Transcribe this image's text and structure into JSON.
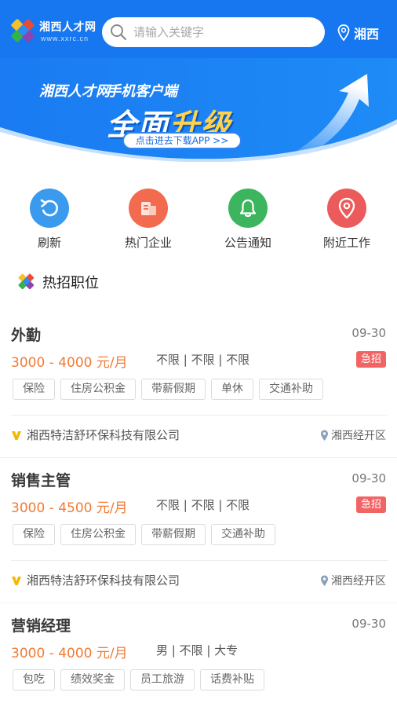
{
  "header": {
    "logo_title": "湘西人才网",
    "logo_url": "www.xxrc.cn",
    "search_placeholder": "请输入关键字",
    "location": "湘西",
    "icons": {
      "search": "search-icon",
      "location": "map-pin-icon"
    },
    "colors": {
      "primary": "#1677f0"
    }
  },
  "banner": {
    "brand": "湘西人才网",
    "client": "手机客户端",
    "main_prefix": "全面",
    "main_highlight": "升级",
    "cta": "点击进去下载APP >>"
  },
  "quick_nav": [
    {
      "label": "刷新",
      "icon": "refresh-icon",
      "color": "#3a9bee"
    },
    {
      "label": "热门企业",
      "icon": "building-icon",
      "color": "#f26b4e"
    },
    {
      "label": "公告通知",
      "icon": "bell-icon",
      "color": "#3cb55e"
    },
    {
      "label": "附近工作",
      "icon": "location-pin-icon",
      "color": "#ec5b5b"
    }
  ],
  "section": {
    "title": "热招职位",
    "icon": "logo-mark-icon"
  },
  "jobs": [
    {
      "title": "外勤",
      "date": "09-30",
      "salary": "3000 - 4000 元/月",
      "requirements": "不限 | 不限 | 不限",
      "urgent": "急招",
      "tags": [
        "保险",
        "住房公积金",
        "带薪假期",
        "单休",
        "交通补助"
      ],
      "company": "湘西特洁舒环保科技有限公司",
      "area": "湘西经开区"
    },
    {
      "title": "销售主管",
      "date": "09-30",
      "salary": "3000 - 4500 元/月",
      "requirements": "不限 | 不限 | 不限",
      "urgent": "急招",
      "tags": [
        "保险",
        "住房公积金",
        "带薪假期",
        "交通补助"
      ],
      "company": "湘西特洁舒环保科技有限公司",
      "area": "湘西经开区"
    },
    {
      "title": "营销经理",
      "date": "09-30",
      "salary": "3000 - 4000 元/月",
      "requirements": "男 | 不限 | 大专",
      "urgent": "",
      "tags": [
        "包吃",
        "绩效奖金",
        "员工旅游",
        "话费补贴"
      ],
      "company": "",
      "area": ""
    }
  ],
  "colors": {
    "salary": "#f17b35",
    "urgent": "#f26364",
    "verified": "#f5b800"
  }
}
